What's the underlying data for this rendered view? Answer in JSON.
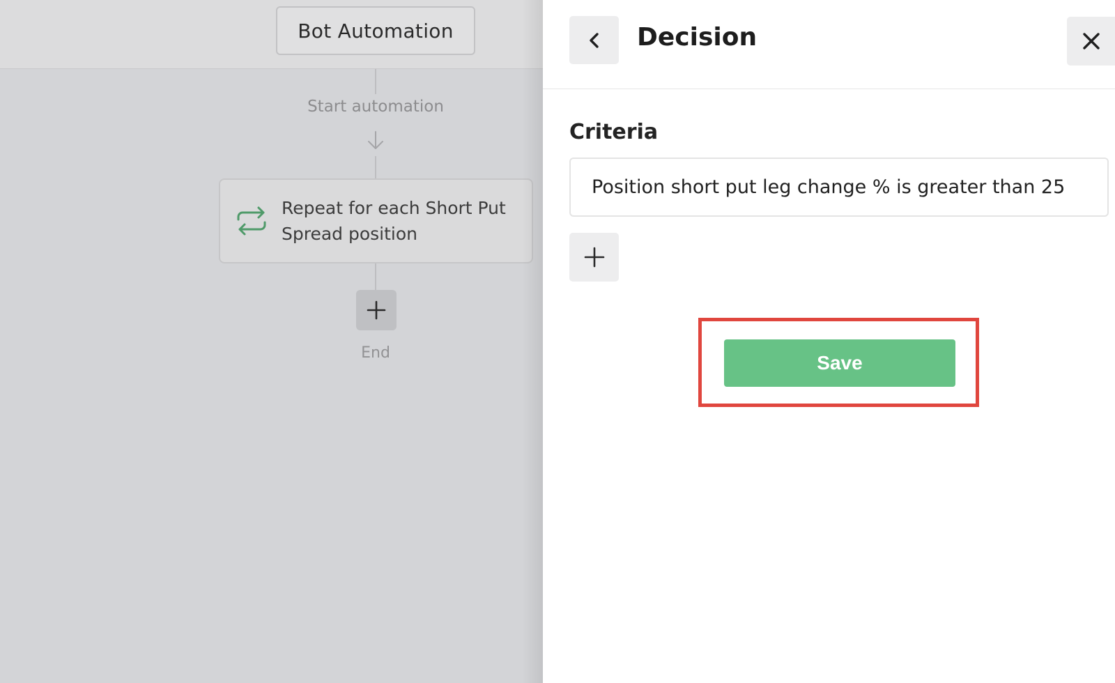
{
  "canvas": {
    "title": "Bot Automation",
    "start_label": "Start automation",
    "loop_node": {
      "icon": "loop-icon",
      "line1": "Repeat for each Short Put",
      "line2": "Spread position"
    },
    "add_step_icon": "plus-icon",
    "end_label": "End"
  },
  "panel": {
    "back_icon": "chevron-left-icon",
    "title": "Decision",
    "close_icon": "close-icon",
    "criteria_label": "Criteria",
    "criteria_value": "Position short put leg change % is greater than 25",
    "add_criteria_icon": "plus-icon",
    "save_label": "Save"
  },
  "colors": {
    "save_button": "#67c286",
    "highlight": "#e0463e",
    "loop_icon": "#4f9a69"
  }
}
